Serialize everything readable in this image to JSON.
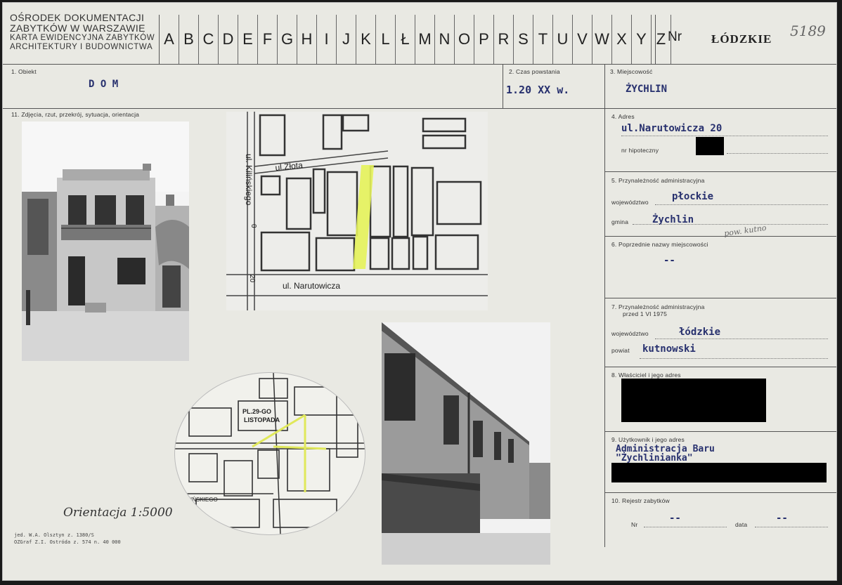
{
  "header": {
    "institution_lines": [
      "OŚRODEK DOKUMENTACJI",
      "ZABYTKÓW W WARSZAWIE",
      "KARTA EWIDENCYJNA ZABYTKÓW",
      "ARCHITEKTURY I BUDOWNICTWA"
    ],
    "letters": [
      "A",
      "B",
      "C",
      "D",
      "E",
      "F",
      "G",
      "H",
      "I",
      "J",
      "K",
      "L",
      "Ł",
      "M",
      "N",
      "O",
      "P",
      "R",
      "S",
      "T",
      "U",
      "V",
      "W",
      "X",
      "Y",
      "Z"
    ],
    "nr_label": "Nr",
    "region": "ŁÓDZKIE",
    "handwritten_number": "5189"
  },
  "fields": {
    "obiekt": {
      "label": "1. Obiekt",
      "value": "D O M"
    },
    "czas": {
      "label": "2. Czas powstania",
      "value": "1.20 XX w."
    },
    "miejscowosc": {
      "label": "3. Miejscowość",
      "value": "ŻYCHLIN"
    },
    "zdjecia": {
      "label": "11. Zdjęcia, rzut, przekrój, sytuacja, orientacja"
    },
    "adres": {
      "label": "4. Adres",
      "value": "ul.Narutowicza 20",
      "hipoteczny_label": "nr hipoteczny"
    },
    "przynaleznosc": {
      "label": "5. Przynależność administracyjna",
      "woj_label": "województwo",
      "woj_value": "płockie",
      "gmina_label": "gmina",
      "gmina_value": "Żychlin",
      "hand_note": "pow. kutno"
    },
    "poprzednie": {
      "label": "6. Poprzednie nazwy miejscowości",
      "value": "--"
    },
    "przed1975": {
      "label_line1": "7. Przynależność administracyjna",
      "label_line2": "przed 1 VI 1975",
      "woj_label": "województwo",
      "woj_value": "łódzkie",
      "powiat_label": "powiat",
      "powiat_value": "kutnowski"
    },
    "wlasciciel": {
      "label": "8. Właściciel i jego adres"
    },
    "uzytkownik": {
      "label": "9. Użytkownik i jego adres",
      "value_line1": "Administracja Baru",
      "value_line2": "\"Żychlinianka\""
    },
    "rejestr": {
      "label": "10. Rejestr zabytków",
      "nr_label": "Nr",
      "nr_value": "--",
      "data_label": "data",
      "data_value": "--"
    }
  },
  "map1": {
    "street_top": "ul.Złota",
    "street_left": "ul. Kilińskiego",
    "street_bottom": "ul. Narutowicza",
    "num_a": "0",
    "num_b": "20"
  },
  "map2": {
    "square_line1": "PL.29-GO",
    "square_line2": "LISTOPADA",
    "street_left": "KILIŃSKIEGO"
  },
  "orientation": "Orientacja 1:5000",
  "footer": {
    "line1": "jed. W.A. Olsztyn z. 1380/S",
    "line2": "OZGraf Z.I. Ostróda z. 574 n. 40 000"
  },
  "colors": {
    "typewriter": "#27306e",
    "highlight": "#e4f25a",
    "card": "#e9e9e3"
  }
}
